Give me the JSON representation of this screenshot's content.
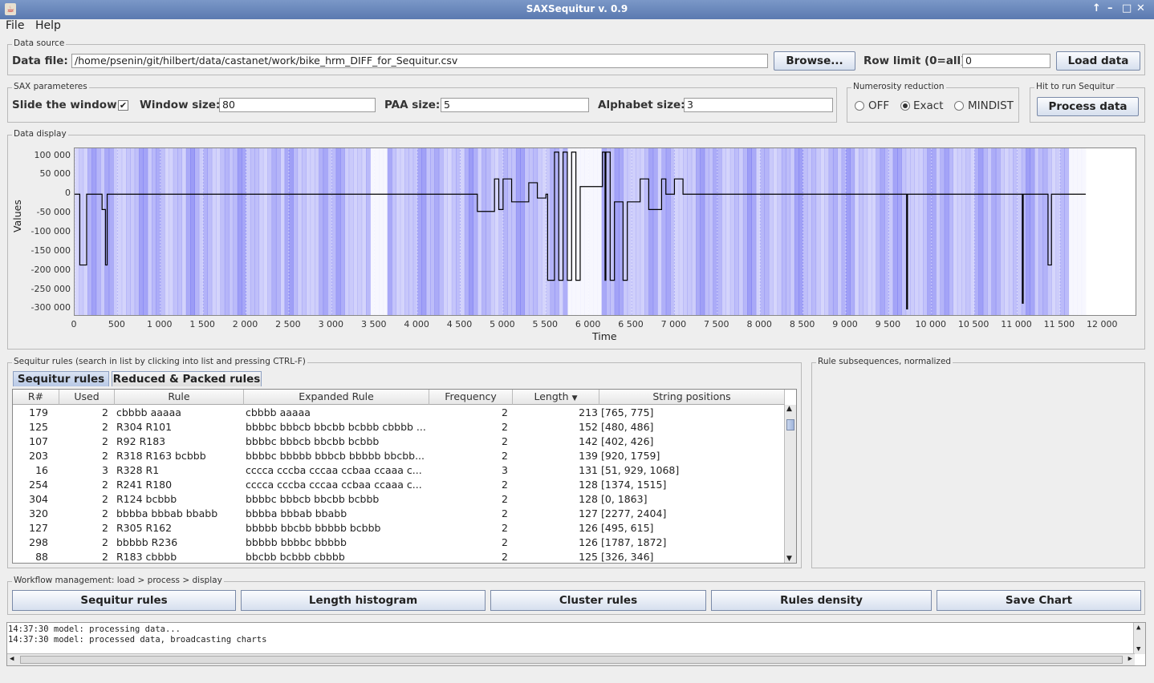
{
  "window": {
    "title": "SAXSequitur v. 0.9"
  },
  "menu": [
    "File",
    "Help"
  ],
  "data_source": {
    "legend": "Data source",
    "file_label": "Data file:",
    "file_value": "/home/psenin/git/hilbert/data/castanet/work/bike_hrm_DIFF_for_Sequitur.csv",
    "browse_label": "Browse...",
    "row_limit_label": "Row limit (0=all):",
    "row_limit_value": "0",
    "load_label": "Load data"
  },
  "sax": {
    "legend": "SAX parameteres",
    "slide_label": "Slide the window",
    "slide_checked": true,
    "window_label": "Window size:",
    "window_value": "80",
    "paa_label": "PAA size:",
    "paa_value": "5",
    "alphabet_label": "Alphabet size:",
    "alphabet_value": "3"
  },
  "numerosity": {
    "legend": "Numerosity reduction",
    "options": [
      "OFF",
      "Exact",
      "MINDIST"
    ],
    "selected": "Exact"
  },
  "run": {
    "legend": "Hit to run Sequitur",
    "button": "Process data"
  },
  "data_display": {
    "legend": "Data display",
    "chart_data": {
      "type": "line",
      "xlabel": "Time",
      "ylabel": "Values",
      "xlim": [
        0,
        12400
      ],
      "ylim": [
        -320000,
        120000
      ],
      "x_ticks": [
        "0",
        "500",
        "1 000",
        "1 500",
        "2 000",
        "2 500",
        "3 000",
        "3 500",
        "4 000",
        "4 500",
        "5 000",
        "5 500",
        "6 000",
        "6 500",
        "7 000",
        "7 500",
        "8 000",
        "8 500",
        "9 000",
        "9 500",
        "10 000",
        "10 500",
        "11 000",
        "11 500",
        "12 000"
      ],
      "y_ticks": [
        "100 000",
        "50 000",
        "0",
        "-50 000",
        "-100 000",
        "-150 000",
        "-200 000",
        "-250 000",
        "-300 000"
      ],
      "series_color": "#000000",
      "density_color": "#5a5af0",
      "x": [
        0,
        50,
        60,
        130,
        140,
        300,
        320,
        360,
        380,
        400,
        500,
        750,
        1000,
        1100,
        1300,
        1500,
        1800,
        2200,
        2600,
        3000,
        3300,
        3400,
        3500,
        3800,
        4000,
        4300,
        4600,
        4700,
        4800,
        4900,
        4950,
        5000,
        5100,
        5300,
        5400,
        5500,
        5520,
        5580,
        5600,
        5650,
        5700,
        5750,
        5800,
        5850,
        5900,
        6150,
        6160,
        6190,
        6200,
        6250,
        6300,
        6400,
        6450,
        6500,
        6600,
        6700,
        6800,
        6850,
        6900,
        7000,
        7100,
        7200,
        7500,
        8000,
        8500,
        9000,
        9500,
        9700,
        9710,
        9720,
        10000,
        10300,
        10500,
        10700,
        10900,
        11000,
        11050,
        11060,
        11070,
        11200,
        11300,
        11350,
        11360,
        11400,
        11500,
        11700,
        11800
      ],
      "values": [
        0,
        0,
        -185000,
        -185000,
        0,
        0,
        -40000,
        -185000,
        0,
        0,
        0,
        0,
        0,
        0,
        0,
        0,
        0,
        0,
        0,
        0,
        0,
        0,
        0,
        0,
        0,
        0,
        0,
        -45000,
        -45000,
        40000,
        -40000,
        40000,
        -20000,
        30000,
        -10000,
        0,
        -225000,
        -225000,
        110000,
        -225000,
        110000,
        -225000,
        110000,
        -225000,
        20000,
        20000,
        110000,
        -225000,
        110000,
        -225000,
        -20000,
        -225000,
        -20000,
        -20000,
        40000,
        -40000,
        -40000,
        40000,
        0,
        40000,
        0,
        0,
        0,
        0,
        0,
        0,
        0,
        0,
        -300000,
        0,
        0,
        0,
        0,
        0,
        0,
        0,
        0,
        -285000,
        0,
        0,
        0,
        0,
        -185000,
        0,
        0,
        0,
        0
      ]
    }
  },
  "rules_panel": {
    "legend": "Sequitur rules (search in list by clicking into list and pressing CTRL-F)",
    "tabs": [
      "Sequitur rules",
      "Reduced & Packed rules"
    ],
    "columns": [
      "R#",
      "Used",
      "Rule",
      "Expanded Rule",
      "Frequency",
      "Length",
      "String positions"
    ],
    "rows": [
      [
        "179",
        "2",
        "cbbbb aaaaa",
        "cbbbb aaaaa",
        "2",
        "213",
        "[765, 775]"
      ],
      [
        "125",
        "2",
        "R304 R101",
        "bbbbc bbbcb bbcbb bcbbb cbbbb ...",
        "2",
        "152",
        "[480, 486]"
      ],
      [
        "107",
        "2",
        "R92 R183",
        "bbbbc bbbcb bbcbb bcbbb",
        "2",
        "142",
        "[402, 426]"
      ],
      [
        "203",
        "2",
        "R318 R163 bcbbb",
        "bbbbc bbbbb bbbcb bbbbb bbcbb...",
        "2",
        "139",
        "[920, 1759]"
      ],
      [
        "16",
        "3",
        "R328 R1",
        "cccca cccba cccaa ccbaa ccaaa c...",
        "3",
        "131",
        "[51, 929, 1068]"
      ],
      [
        "254",
        "2",
        "R241 R180",
        "cccca cccba cccaa ccbaa ccaaa c...",
        "2",
        "128",
        "[1374, 1515]"
      ],
      [
        "304",
        "2",
        "R124 bcbbb",
        "bbbbc bbbcb bbcbb bcbbb",
        "2",
        "128",
        "[0, 1863]"
      ],
      [
        "320",
        "2",
        "bbbba bbbab bbabb",
        "bbbba bbbab bbabb",
        "2",
        "127",
        "[2277, 2404]"
      ],
      [
        "127",
        "2",
        "R305 R162",
        "bbbbb bbcbb bbbbb bcbbb",
        "2",
        "126",
        "[495, 615]"
      ],
      [
        "298",
        "2",
        "bbbbb R236",
        "bbbbb bbbbc bbbbb",
        "2",
        "126",
        "[1787, 1872]"
      ],
      [
        "88",
        "2",
        "R183 cbbbb",
        "bbcbb bcbbb cbbbb",
        "2",
        "125",
        "[326, 346]"
      ]
    ]
  },
  "subseq_panel": {
    "legend": "Rule subsequences, normalized"
  },
  "workflow": {
    "legend": "Workflow management: load > process > display",
    "buttons": [
      "Sequitur rules",
      "Length histogram",
      "Cluster rules",
      "Rules density",
      "Save Chart"
    ]
  },
  "log": [
    "14:37:30 model: processing data...",
    "14:37:30 model: processed data, broadcasting charts"
  ]
}
